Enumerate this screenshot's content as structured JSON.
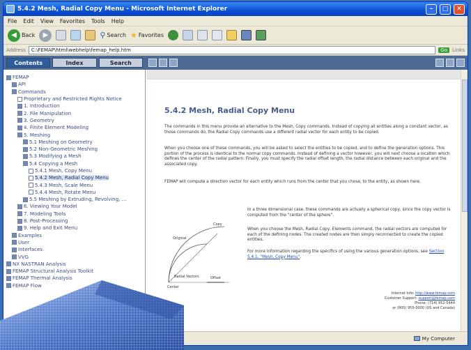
{
  "window": {
    "title": "5.4.2 Mesh, Radial Copy Menu - Microsoft Internet Explorer"
  },
  "menu": [
    "File",
    "Edit",
    "View",
    "Favorites",
    "Tools",
    "Help"
  ],
  "toolbar": {
    "back": "Back",
    "search": "Search",
    "favorites": "Favorites"
  },
  "address": {
    "label": "Address",
    "value": "C:\\FEMAP\\html\\webhelp\\femap_help.htm",
    "go": "Go",
    "links": "Links"
  },
  "help": {
    "tabs": [
      "Contents",
      "Index",
      "Search"
    ],
    "tree": [
      {
        "label": "FEMAP",
        "level": 0,
        "icon": "book"
      },
      {
        "label": "API",
        "level": 1,
        "icon": "book"
      },
      {
        "label": "Commands",
        "level": 1,
        "icon": "book"
      },
      {
        "label": "Proprietary and Restricted Rights Notice",
        "level": 2,
        "icon": "doc"
      },
      {
        "label": "1. Introduction",
        "level": 2,
        "icon": "book"
      },
      {
        "label": "2. File Manipulation",
        "level": 2,
        "icon": "book"
      },
      {
        "label": "3. Geometry",
        "level": 2,
        "icon": "book"
      },
      {
        "label": "4. Finite Element Modeling",
        "level": 2,
        "icon": "book"
      },
      {
        "label": "5. Meshing",
        "level": 2,
        "icon": "book"
      },
      {
        "label": "5.1 Meshing on Geometry",
        "level": 3,
        "icon": "book"
      },
      {
        "label": "5.2 Non-Geometric Meshing",
        "level": 3,
        "icon": "book"
      },
      {
        "label": "5.3 Modifying a Mesh",
        "level": 3,
        "icon": "book"
      },
      {
        "label": "5.4 Copying a Mesh",
        "level": 3,
        "icon": "book"
      },
      {
        "label": "5.4.1 Mesh, Copy Menu",
        "level": 4,
        "icon": "doc"
      },
      {
        "label": "5.4.2 Mesh, Radial Copy Menu",
        "level": 4,
        "icon": "doc",
        "selected": true
      },
      {
        "label": "5.4.3 Mesh, Scale Menu",
        "level": 4,
        "icon": "doc"
      },
      {
        "label": "5.4.4 Mesh, Rotate Menu",
        "level": 4,
        "icon": "doc"
      },
      {
        "label": "5.5 Meshing by Extruding, Revolving, ...",
        "level": 3,
        "icon": "book"
      },
      {
        "label": "6. Viewing Your Model",
        "level": 2,
        "icon": "book"
      },
      {
        "label": "7. Modeling Tools",
        "level": 2,
        "icon": "book"
      },
      {
        "label": "8. Post-Processing",
        "level": 2,
        "icon": "book"
      },
      {
        "label": "9. Help and Exit Menu",
        "level": 2,
        "icon": "book"
      },
      {
        "label": "Examples",
        "level": 1,
        "icon": "book"
      },
      {
        "label": "User",
        "level": 1,
        "icon": "book"
      },
      {
        "label": "Interfaces",
        "level": 1,
        "icon": "book"
      },
      {
        "label": "VVG",
        "level": 1,
        "icon": "book"
      },
      {
        "label": "NX NASTRAN Analysis",
        "level": 0,
        "icon": "book"
      },
      {
        "label": "FEMAP Structural Analysis Toolkit",
        "level": 0,
        "icon": "book"
      },
      {
        "label": "FEMAP Thermal Analysis",
        "level": 0,
        "icon": "book"
      },
      {
        "label": "FEMAP Flow",
        "level": 0,
        "icon": "book"
      }
    ]
  },
  "article": {
    "title": "5.4.2 Mesh, Radial Copy Menu",
    "p1": "The commands in this menu provide an alternative to the Mesh, Copy commands. Instead of copying all entities along a constant vector, as those commands do, the Radial Copy commands use a different radial vector for each entity to be copied.",
    "p2": "When you choose one of these commands, you will be asked to select the entities to be copied, and to define the generation options. This portion of the process is identical to the normal copy commands. Instead of defining a vector however, you will next choose a location which defines the center of the radial pattern. Finally, you must specify the radial offset length, the radial distance between each original and the associated copy.",
    "p3": "FEMAP will compute a direction vector for each entity which runs from the center that you chose, to the entity, as shown here.",
    "p4": "In a three dimensional case, these commands are actually a spherical copy, since the copy vector is computed from the \"center of the sphere\".",
    "p5": "When you choose the Mesh, Radial Copy, Elements command, the radial vectors are computed for each of the defining nodes. The created nodes are then simply reconnected to create the copied entities.",
    "p6_pre": "For more information regarding the specifics of using the various generation options, see ",
    "p6_link": "Section 5.4.1, \"Mesh, Copy Menu\"",
    "p6_post": "."
  },
  "diagram_labels": {
    "copy": "Copy",
    "original": "Original",
    "radial_vectors": "Radial Vectors",
    "offset": "Offset",
    "center": "Center"
  },
  "contact": {
    "l1a": "Internet Info: ",
    "l1b": "http://www.femap.com",
    "l2a": "Customer Support: ",
    "l2b": "support@femap.com",
    "l3": "Phone: (714) 952-5444",
    "l4": "or (800) 955-0000 (US and Canada)"
  },
  "status": {
    "zone": "My Computer"
  }
}
